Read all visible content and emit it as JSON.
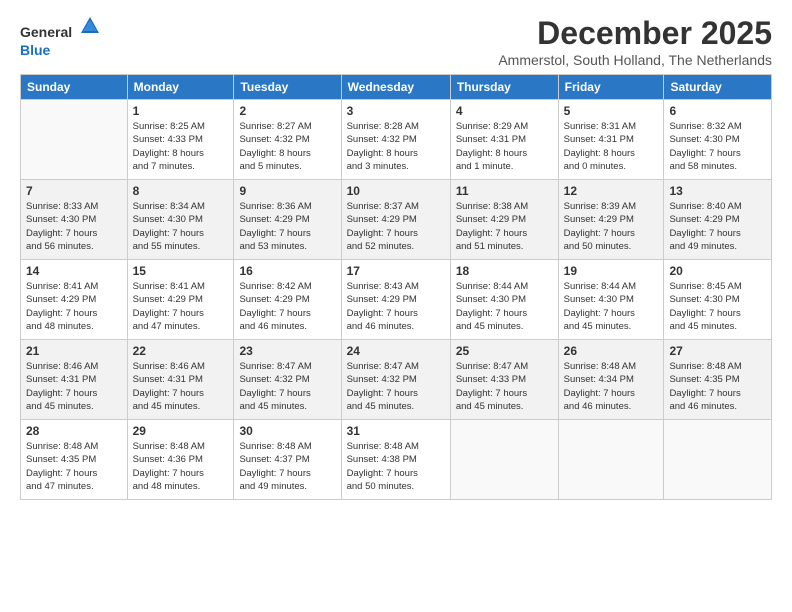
{
  "logo": {
    "general": "General",
    "blue": "Blue"
  },
  "header": {
    "month": "December 2025",
    "location": "Ammerstol, South Holland, The Netherlands"
  },
  "days_of_week": [
    "Sunday",
    "Monday",
    "Tuesday",
    "Wednesday",
    "Thursday",
    "Friday",
    "Saturday"
  ],
  "weeks": [
    [
      {
        "day": "",
        "info": ""
      },
      {
        "day": "1",
        "info": "Sunrise: 8:25 AM\nSunset: 4:33 PM\nDaylight: 8 hours\nand 7 minutes."
      },
      {
        "day": "2",
        "info": "Sunrise: 8:27 AM\nSunset: 4:32 PM\nDaylight: 8 hours\nand 5 minutes."
      },
      {
        "day": "3",
        "info": "Sunrise: 8:28 AM\nSunset: 4:32 PM\nDaylight: 8 hours\nand 3 minutes."
      },
      {
        "day": "4",
        "info": "Sunrise: 8:29 AM\nSunset: 4:31 PM\nDaylight: 8 hours\nand 1 minute."
      },
      {
        "day": "5",
        "info": "Sunrise: 8:31 AM\nSunset: 4:31 PM\nDaylight: 8 hours\nand 0 minutes."
      },
      {
        "day": "6",
        "info": "Sunrise: 8:32 AM\nSunset: 4:30 PM\nDaylight: 7 hours\nand 58 minutes."
      }
    ],
    [
      {
        "day": "7",
        "info": "Sunrise: 8:33 AM\nSunset: 4:30 PM\nDaylight: 7 hours\nand 56 minutes."
      },
      {
        "day": "8",
        "info": "Sunrise: 8:34 AM\nSunset: 4:30 PM\nDaylight: 7 hours\nand 55 minutes."
      },
      {
        "day": "9",
        "info": "Sunrise: 8:36 AM\nSunset: 4:29 PM\nDaylight: 7 hours\nand 53 minutes."
      },
      {
        "day": "10",
        "info": "Sunrise: 8:37 AM\nSunset: 4:29 PM\nDaylight: 7 hours\nand 52 minutes."
      },
      {
        "day": "11",
        "info": "Sunrise: 8:38 AM\nSunset: 4:29 PM\nDaylight: 7 hours\nand 51 minutes."
      },
      {
        "day": "12",
        "info": "Sunrise: 8:39 AM\nSunset: 4:29 PM\nDaylight: 7 hours\nand 50 minutes."
      },
      {
        "day": "13",
        "info": "Sunrise: 8:40 AM\nSunset: 4:29 PM\nDaylight: 7 hours\nand 49 minutes."
      }
    ],
    [
      {
        "day": "14",
        "info": "Sunrise: 8:41 AM\nSunset: 4:29 PM\nDaylight: 7 hours\nand 48 minutes."
      },
      {
        "day": "15",
        "info": "Sunrise: 8:41 AM\nSunset: 4:29 PM\nDaylight: 7 hours\nand 47 minutes."
      },
      {
        "day": "16",
        "info": "Sunrise: 8:42 AM\nSunset: 4:29 PM\nDaylight: 7 hours\nand 46 minutes."
      },
      {
        "day": "17",
        "info": "Sunrise: 8:43 AM\nSunset: 4:29 PM\nDaylight: 7 hours\nand 46 minutes."
      },
      {
        "day": "18",
        "info": "Sunrise: 8:44 AM\nSunset: 4:30 PM\nDaylight: 7 hours\nand 45 minutes."
      },
      {
        "day": "19",
        "info": "Sunrise: 8:44 AM\nSunset: 4:30 PM\nDaylight: 7 hours\nand 45 minutes."
      },
      {
        "day": "20",
        "info": "Sunrise: 8:45 AM\nSunset: 4:30 PM\nDaylight: 7 hours\nand 45 minutes."
      }
    ],
    [
      {
        "day": "21",
        "info": "Sunrise: 8:46 AM\nSunset: 4:31 PM\nDaylight: 7 hours\nand 45 minutes."
      },
      {
        "day": "22",
        "info": "Sunrise: 8:46 AM\nSunset: 4:31 PM\nDaylight: 7 hours\nand 45 minutes."
      },
      {
        "day": "23",
        "info": "Sunrise: 8:47 AM\nSunset: 4:32 PM\nDaylight: 7 hours\nand 45 minutes."
      },
      {
        "day": "24",
        "info": "Sunrise: 8:47 AM\nSunset: 4:32 PM\nDaylight: 7 hours\nand 45 minutes."
      },
      {
        "day": "25",
        "info": "Sunrise: 8:47 AM\nSunset: 4:33 PM\nDaylight: 7 hours\nand 45 minutes."
      },
      {
        "day": "26",
        "info": "Sunrise: 8:48 AM\nSunset: 4:34 PM\nDaylight: 7 hours\nand 46 minutes."
      },
      {
        "day": "27",
        "info": "Sunrise: 8:48 AM\nSunset: 4:35 PM\nDaylight: 7 hours\nand 46 minutes."
      }
    ],
    [
      {
        "day": "28",
        "info": "Sunrise: 8:48 AM\nSunset: 4:35 PM\nDaylight: 7 hours\nand 47 minutes."
      },
      {
        "day": "29",
        "info": "Sunrise: 8:48 AM\nSunset: 4:36 PM\nDaylight: 7 hours\nand 48 minutes."
      },
      {
        "day": "30",
        "info": "Sunrise: 8:48 AM\nSunset: 4:37 PM\nDaylight: 7 hours\nand 49 minutes."
      },
      {
        "day": "31",
        "info": "Sunrise: 8:48 AM\nSunset: 4:38 PM\nDaylight: 7 hours\nand 50 minutes."
      },
      {
        "day": "",
        "info": ""
      },
      {
        "day": "",
        "info": ""
      },
      {
        "day": "",
        "info": ""
      }
    ]
  ]
}
